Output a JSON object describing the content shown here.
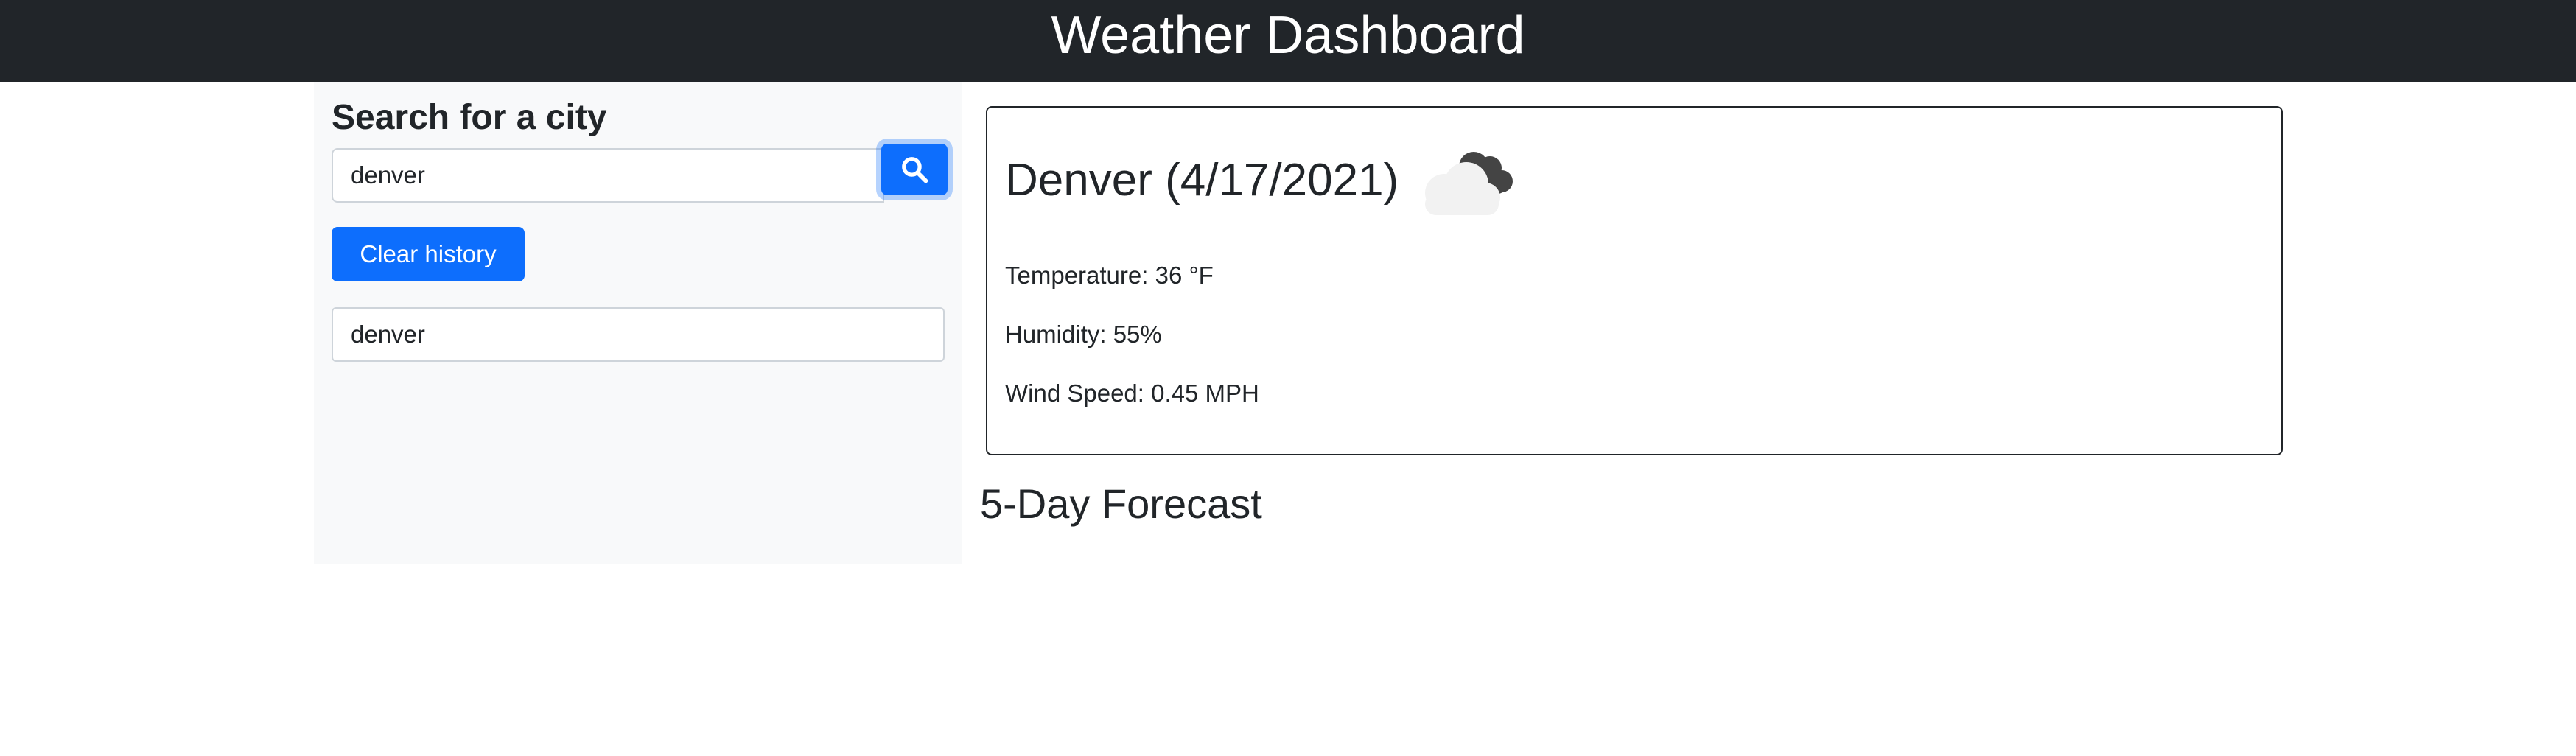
{
  "header": {
    "title": "Weather Dashboard"
  },
  "sidebar": {
    "heading": "Search for a city",
    "search": {
      "value": "denver",
      "icon": "search-icon"
    },
    "clear_label": "Clear history",
    "history": [
      "denver"
    ]
  },
  "current": {
    "title": "Denver (4/17/2021)",
    "icon": "cloud-icon",
    "temperature": "Temperature: 36 °F",
    "humidity": "Humidity: 55%",
    "wind": "Wind Speed: 0.45 MPH"
  },
  "forecast": {
    "heading": "5-Day Forecast"
  },
  "colors": {
    "navbar": "#212529",
    "primary": "#0d6efd",
    "sidebar_bg": "#f8f9fa"
  }
}
